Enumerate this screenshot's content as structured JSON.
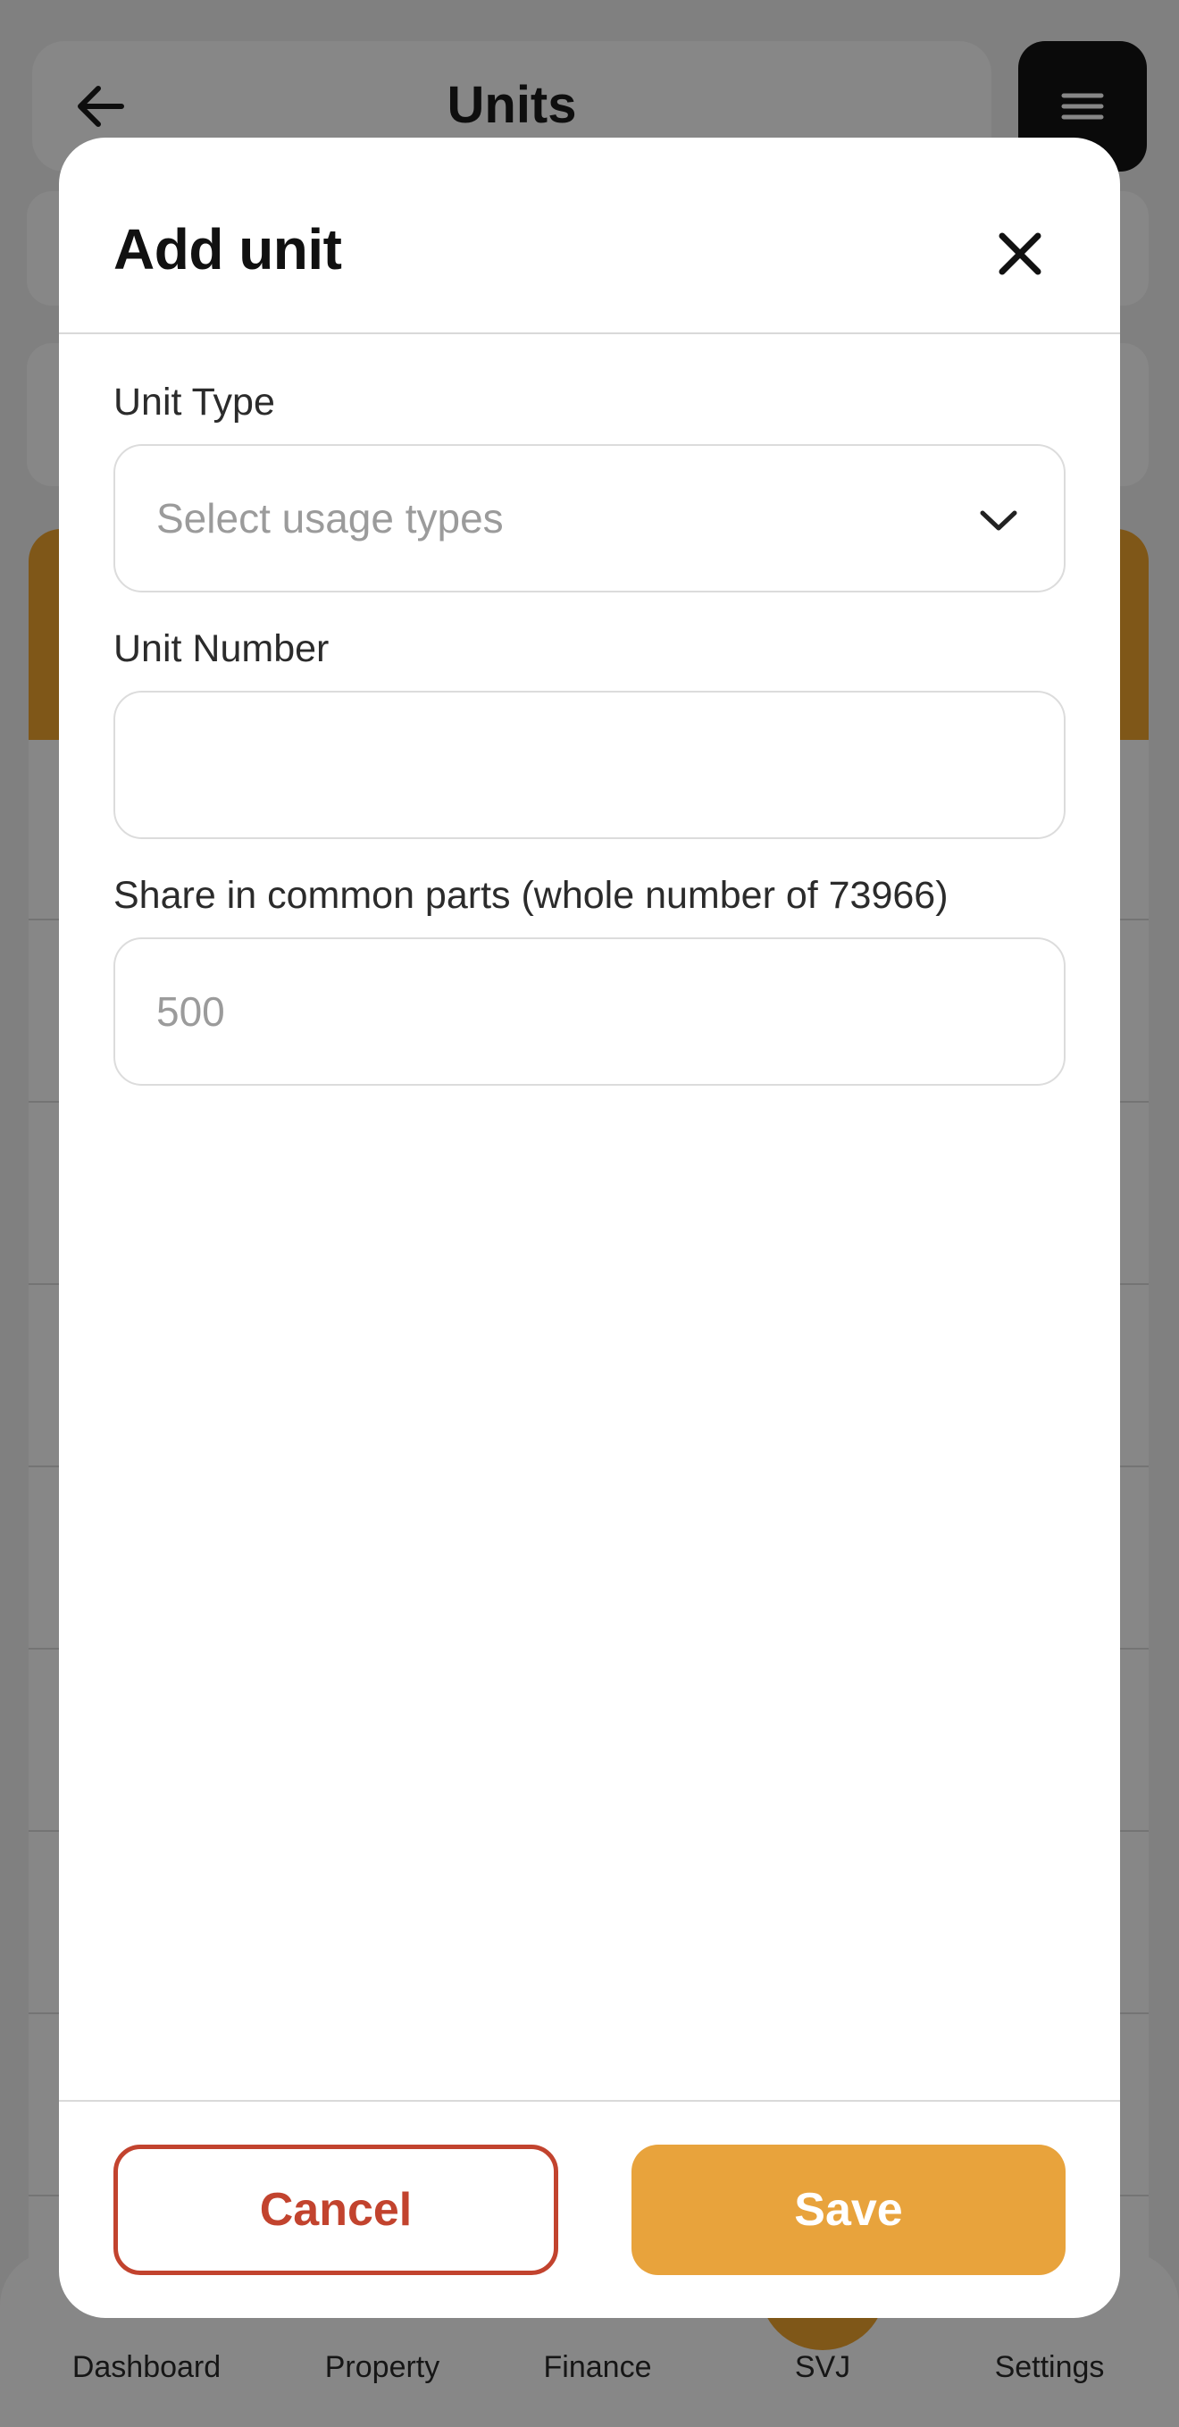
{
  "background": {
    "page_title": "Units",
    "nav": {
      "items": [
        {
          "label": "Dashboard"
        },
        {
          "label": "Property"
        },
        {
          "label": "Finance"
        },
        {
          "label": "SVJ"
        },
        {
          "label": "Settings"
        }
      ]
    },
    "colors": {
      "accent": "#f0a42e",
      "menu_button": "#141414"
    }
  },
  "modal": {
    "title": "Add unit",
    "close_icon": "close-icon",
    "fields": {
      "unit_type": {
        "label": "Unit Type",
        "placeholder": "Select usage types",
        "icon": "chevron-down-icon"
      },
      "unit_number": {
        "label": "Unit Number",
        "value": ""
      },
      "share": {
        "label": "Share in common parts (whole number of 73966)",
        "placeholder": "500"
      }
    },
    "buttons": {
      "cancel": "Cancel",
      "save": "Save"
    },
    "colors": {
      "cancel": "#c2432e",
      "save": "#e8a33c"
    }
  }
}
